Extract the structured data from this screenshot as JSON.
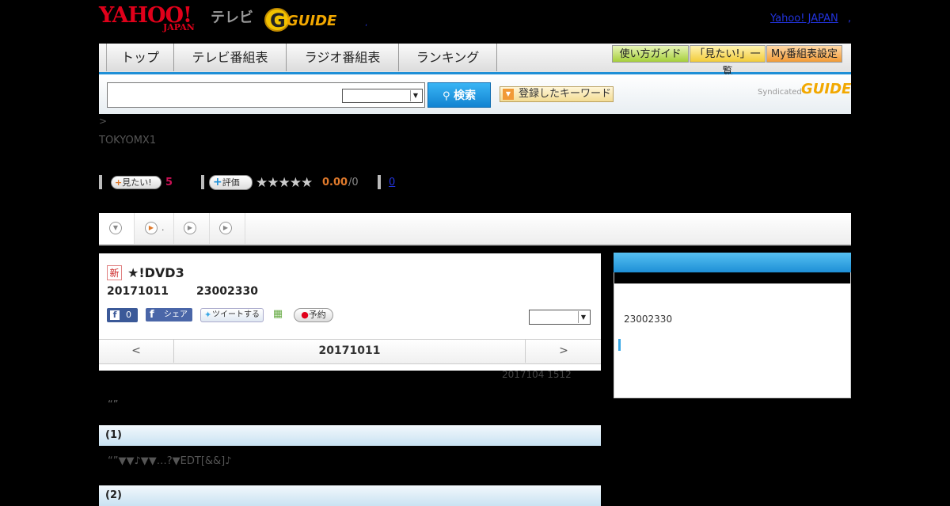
{
  "header": {
    "yahoo_logo": "YAHOO!",
    "japan_logo": "JAPAN",
    "tv_label": "テレビ",
    "gguide_logo": "GUIDE",
    "yahoo_japan_link": "Yahoo! JAPAN",
    "separator": ",",
    "dot": ","
  },
  "nav": {
    "tabs": [
      "トップ",
      "テレビ番組表",
      "ラジオ番組表",
      "ランキング"
    ],
    "utility": [
      "使い方ガイド",
      "「見たい!」一覧",
      "My番組表設定"
    ]
  },
  "search": {
    "button_label": "検索",
    "keyword_label": "登録したキーワード",
    "syndicated_label": "Syndicated",
    "syndicated_logo": "GUIDE"
  },
  "breadcrumb": ">",
  "station": "TOKYOMX1",
  "stats": {
    "want_label": "見たい!",
    "want_count": "5",
    "review_label": "評価",
    "stars": "★★★★★",
    "score": "0.00",
    "score_count": "/0",
    "review_count": "0"
  },
  "tab_strip": {
    "tab2_text": "."
  },
  "program": {
    "new_badge": "新",
    "title": "★!DVD3",
    "date": "20171011",
    "time": "23002330",
    "fb_like_count": "0",
    "fb_share": "シェア",
    "tweet": "ツイートする",
    "reserve": "予約"
  },
  "date_nav": {
    "prev": "<",
    "current": "20171011",
    "next": ">"
  },
  "updated": "2017104  1512",
  "quote": "“”",
  "sections": [
    {
      "heading": "(1)",
      "body": "“”▼▼♪▼▼…?▼EDT[&&]♪"
    },
    {
      "heading": "(2)"
    }
  ],
  "sidebar": {
    "time": "23002330"
  },
  "colors": {
    "accent_blue": "#1e8fd6",
    "yahoo_red": "#e0001a",
    "gguide_yellow": "#f2a800",
    "want_pink": "#cc1155",
    "score_orange": "#e07a2c"
  }
}
